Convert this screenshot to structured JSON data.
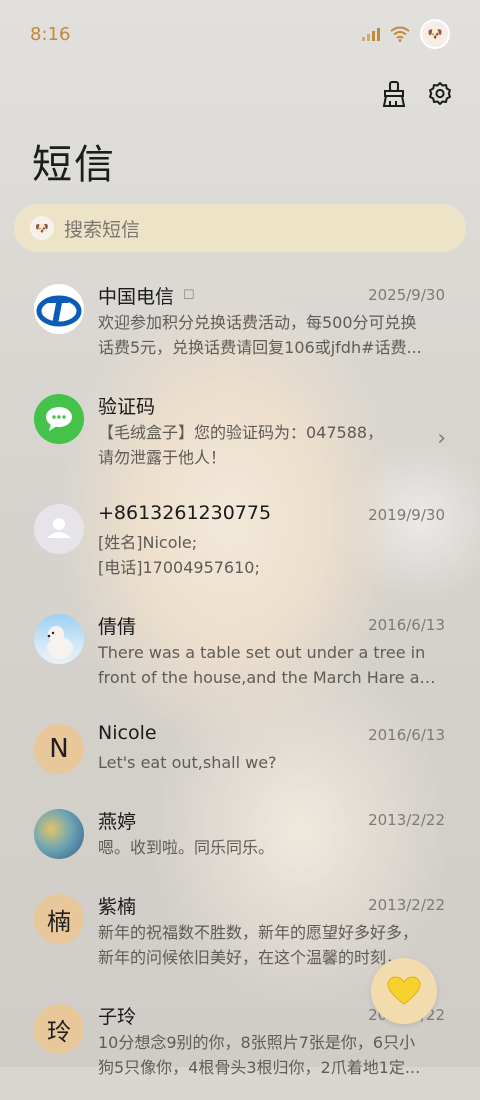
{
  "status": {
    "time": "8:16"
  },
  "header": {
    "title": "短信"
  },
  "search": {
    "placeholder": "搜索短信"
  },
  "messages": [
    {
      "name": "中国电信",
      "date": "2025/9/30",
      "lines": [
        "欢迎参加积分兑换话费活动，每500分可兑换",
        "话费5元，兑换话费请回复106或jfdh#话费..."
      ],
      "avatar": "telecom-logo"
    },
    {
      "name": "验证码",
      "date": "",
      "lines": [
        "【毛绒盒子】您的验证码为：047588，",
        "请勿泄露于他人！"
      ],
      "avatar": "sms-bubble"
    },
    {
      "name": "+8613261230775",
      "date": "2019/9/30",
      "lines": [
        "[姓名]Nicole;",
        "[电话]17004957610;"
      ],
      "avatar": "person-placeholder"
    },
    {
      "name": "倩倩",
      "date": "2016/6/13",
      "lines": [
        "There was a table set out under a tree in",
        "front of the house,and the March Hare an..."
      ],
      "avatar": "polar-bear-photo"
    },
    {
      "name": "Nicole",
      "date": "2016/6/13",
      "lines": [
        "Let's eat out,shall we?"
      ],
      "avatar": "N"
    },
    {
      "name": "燕婷",
      "date": "2013/2/22",
      "lines": [
        "嗯。收到啦。同乐同乐。"
      ],
      "avatar": "landscape-photo"
    },
    {
      "name": "紫楠",
      "date": "2013/2/22",
      "lines": [
        "新年的祝福数不胜数，新年的愿望好多好多，",
        "新年的问候依旧美好，在这个温馨的时刻，..."
      ],
      "avatar": "楠"
    },
    {
      "name": "子玲",
      "date": "2013/2/22",
      "lines": [
        "10分想念9别的你，8张照片7张是你，6只小",
        "狗5只像你，4根骨头3根归你，2爪着地1定..."
      ],
      "avatar": "玲"
    }
  ],
  "colors": {
    "accent": "#c08a3c",
    "letter_avatar": "#e8c79a",
    "fab": "#f2dcae",
    "search_bg": "#f0e4c4"
  }
}
